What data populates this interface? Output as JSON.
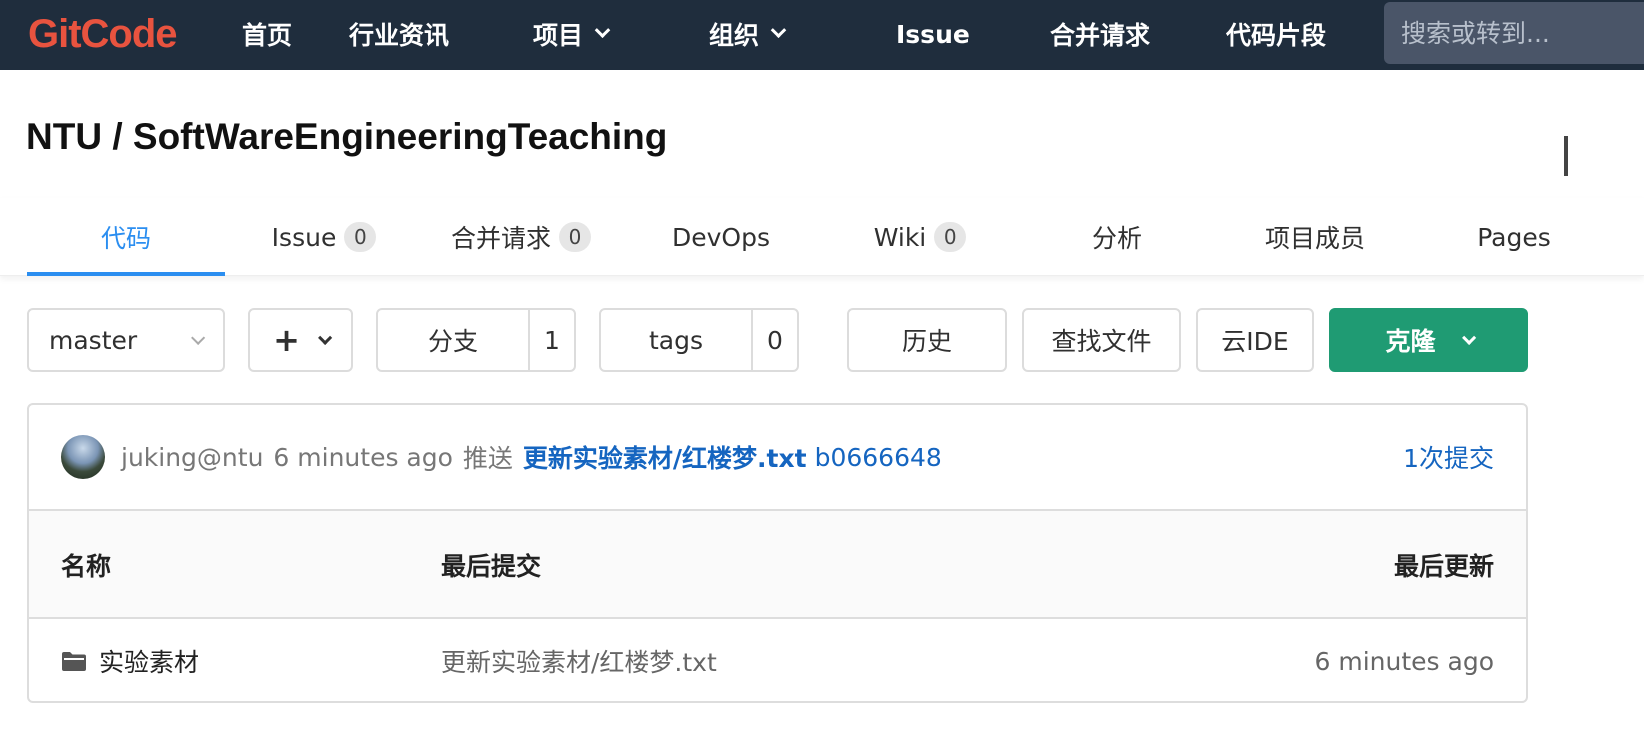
{
  "navbar": {
    "logo": "GitCode",
    "items": [
      "首页",
      "行业资讯",
      "项目",
      "组织",
      "Issue",
      "合并请求",
      "代码片段"
    ],
    "search_placeholder": "搜索或转到..."
  },
  "project": {
    "namespace": "NTU",
    "separator": " / ",
    "name": "SoftWareEngineeringTeaching"
  },
  "tabs": [
    {
      "label": "代码"
    },
    {
      "label": "Issue",
      "count": "0"
    },
    {
      "label": "合并请求",
      "count": "0"
    },
    {
      "label": "DevOps"
    },
    {
      "label": "Wiki",
      "count": "0"
    },
    {
      "label": "分析"
    },
    {
      "label": "项目成员"
    },
    {
      "label": "Pages"
    }
  ],
  "toolbar": {
    "branch": "master",
    "plus": "+",
    "branches_label": "分支",
    "branches_count": "1",
    "tags_label": "tags",
    "tags_count": "0",
    "history": "历史",
    "find_file": "查找文件",
    "cloud_ide": "云IDE",
    "clone": "克隆"
  },
  "commit": {
    "author": "juking@ntu",
    "time": "6 minutes ago",
    "action": "推送",
    "message": "更新实验素材/红楼梦.txt",
    "sha": "b0666648",
    "commit_count": "1次提交"
  },
  "table": {
    "headers": {
      "name": "名称",
      "last_commit": "最后提交",
      "last_update": "最后更新"
    },
    "rows": [
      {
        "name": "实验素材",
        "last_commit": "更新实验素材/红楼梦.txt",
        "last_update": "6 minutes ago"
      }
    ]
  },
  "colors": {
    "navbar_bg": "#1f2d3d",
    "logo": "#e8533f",
    "active_tab": "#2b8ef0",
    "clone_button": "#1f9b73",
    "link": "#1565c0"
  }
}
